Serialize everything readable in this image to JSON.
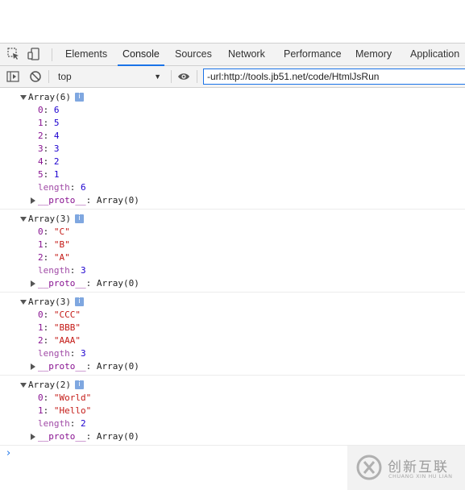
{
  "devtools": {
    "tabs": [
      "Elements",
      "Console",
      "Sources",
      "Network",
      "Performance",
      "Memory",
      "Application"
    ],
    "active_tab": "Console",
    "context_selector": "top",
    "filter_value": "-url:http://tools.jb51.net/code/HtmlJsRun"
  },
  "console": {
    "groups": [
      {
        "header": "Array(6)",
        "entries": [
          {
            "key": "0",
            "value": "6"
          },
          {
            "key": "1",
            "value": "5"
          },
          {
            "key": "2",
            "value": "4"
          },
          {
            "key": "3",
            "value": "3"
          },
          {
            "key": "4",
            "value": "2"
          },
          {
            "key": "5",
            "value": "1"
          }
        ],
        "length": "6",
        "proto": "Array(0)"
      },
      {
        "header": "Array(3)",
        "entries": [
          {
            "key": "0",
            "value": "\"C\""
          },
          {
            "key": "1",
            "value": "\"B\""
          },
          {
            "key": "2",
            "value": "\"A\""
          }
        ],
        "length": "3",
        "proto": "Array(0)"
      },
      {
        "header": "Array(3)",
        "entries": [
          {
            "key": "0",
            "value": "\"CCC\""
          },
          {
            "key": "1",
            "value": "\"BBB\""
          },
          {
            "key": "2",
            "value": "\"AAA\""
          }
        ],
        "length": "3",
        "proto": "Array(0)"
      },
      {
        "header": "Array(2)",
        "entries": [
          {
            "key": "0",
            "value": "\"World\""
          },
          {
            "key": "1",
            "value": "\"Hello\""
          }
        ],
        "length": "2",
        "proto": "Array(0)"
      }
    ],
    "prompt": "›"
  },
  "watermark": {
    "text": "创新互联",
    "subtext": "CHUANG XIN HU LIAN"
  },
  "colors": {
    "accent": "#1a73e8",
    "key": "#881391",
    "number": "#1c00cf",
    "string": "#c41a16"
  }
}
